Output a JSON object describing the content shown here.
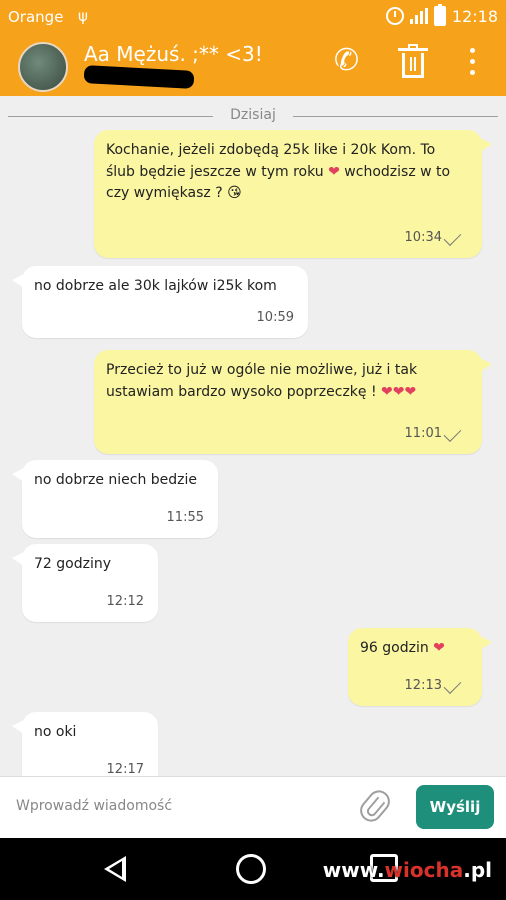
{
  "status_bar": {
    "carrier": "Orange",
    "time": "12:18"
  },
  "header": {
    "contact_name": "Aa Mężuś. ;** <3!"
  },
  "date_divider": "Dzisiaj",
  "messages": [
    {
      "direction": "out",
      "text": "Kochanie, jeżeli zdobędą 25k like i 20k Kom. To ślub będzie jeszcze w tym roku",
      "emoji_suffix": "❤",
      "text2": " wchodzisz w to czy wymiękasz ?",
      "emoji2": "😘",
      "time": "10:34"
    },
    {
      "direction": "in",
      "text": "no dobrze ale 30k lajków i25k kom",
      "time": "10:59"
    },
    {
      "direction": "out",
      "text": "Przecież to już w ogóle nie możliwe, już i tak ustawiam bardzo wysoko poprzeczkę !",
      "emoji_suffix": "❤❤❤",
      "time": "11:01"
    },
    {
      "direction": "in",
      "text": "no dobrze niech bedzie",
      "time": "11:55"
    },
    {
      "direction": "in",
      "text": "72 godziny",
      "time": "12:12"
    },
    {
      "direction": "out",
      "text": "96 godzin",
      "emoji_suffix": "❤",
      "time": "12:13"
    },
    {
      "direction": "in",
      "text": "no oki",
      "time": "12:17"
    }
  ],
  "composer": {
    "placeholder": "Wprowadź wiadomość",
    "send_label": "Wyślij"
  },
  "watermark": {
    "prefix": "www.",
    "brand": "wiocha",
    "suffix": ".pl"
  },
  "colors": {
    "header_bg": "#f7a21b",
    "outgoing_bubble": "#fbf6a2",
    "incoming_bubble": "#ffffff",
    "send_button": "#1e8f7a",
    "chat_bg": "#efefef"
  }
}
